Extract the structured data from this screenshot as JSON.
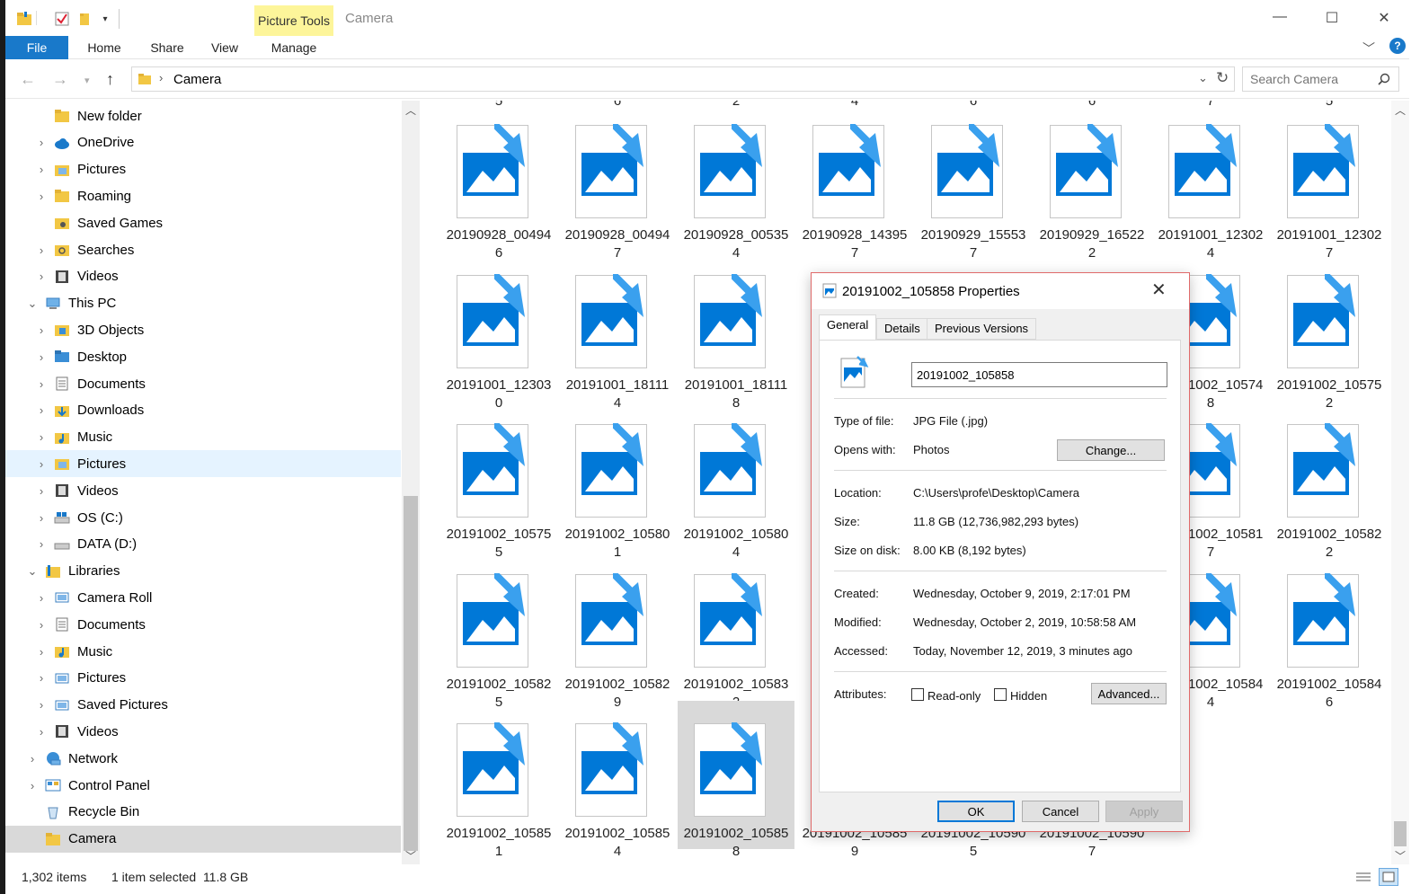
{
  "window": {
    "title": "Camera",
    "context_tab": "Picture Tools",
    "ribbon_tabs": [
      "File",
      "Home",
      "Share",
      "View",
      "Manage"
    ]
  },
  "address": {
    "path": "Camera",
    "search_placeholder": "Search Camera"
  },
  "nav_tree": [
    {
      "label": "New folder",
      "indent": 2,
      "chevron": "",
      "icon": "folder"
    },
    {
      "label": "OneDrive",
      "indent": 2,
      "chevron": ">",
      "icon": "cloud"
    },
    {
      "label": "Pictures",
      "indent": 2,
      "chevron": ">",
      "icon": "folder-pic"
    },
    {
      "label": "Roaming",
      "indent": 2,
      "chevron": ">",
      "icon": "folder"
    },
    {
      "label": "Saved Games",
      "indent": 2,
      "chevron": "",
      "icon": "folder-game"
    },
    {
      "label": "Searches",
      "indent": 2,
      "chevron": ">",
      "icon": "folder-search"
    },
    {
      "label": "Videos",
      "indent": 2,
      "chevron": ">",
      "icon": "video"
    },
    {
      "label": "This PC",
      "indent": 1,
      "chevron": "v",
      "icon": "pc"
    },
    {
      "label": "3D Objects",
      "indent": 2,
      "chevron": ">",
      "icon": "folder-3d"
    },
    {
      "label": "Desktop",
      "indent": 2,
      "chevron": ">",
      "icon": "desktop"
    },
    {
      "label": "Documents",
      "indent": 2,
      "chevron": ">",
      "icon": "doc"
    },
    {
      "label": "Downloads",
      "indent": 2,
      "chevron": ">",
      "icon": "download"
    },
    {
      "label": "Music",
      "indent": 2,
      "chevron": ">",
      "icon": "music"
    },
    {
      "label": "Pictures",
      "indent": 2,
      "chevron": ">",
      "icon": "folder-pic",
      "state": "hover"
    },
    {
      "label": "Videos",
      "indent": 2,
      "chevron": ">",
      "icon": "video"
    },
    {
      "label": "OS (C:)",
      "indent": 2,
      "chevron": ">",
      "icon": "drive-os"
    },
    {
      "label": "DATA (D:)",
      "indent": 2,
      "chevron": ">",
      "icon": "drive"
    },
    {
      "label": "Libraries",
      "indent": 1,
      "chevron": "v",
      "icon": "library"
    },
    {
      "label": "Camera Roll",
      "indent": 2,
      "chevron": ">",
      "icon": "lib-pic"
    },
    {
      "label": "Documents",
      "indent": 2,
      "chevron": ">",
      "icon": "doc"
    },
    {
      "label": "Music",
      "indent": 2,
      "chevron": ">",
      "icon": "music"
    },
    {
      "label": "Pictures",
      "indent": 2,
      "chevron": ">",
      "icon": "lib-pic"
    },
    {
      "label": "Saved Pictures",
      "indent": 2,
      "chevron": ">",
      "icon": "lib-pic"
    },
    {
      "label": "Videos",
      "indent": 2,
      "chevron": ">",
      "icon": "video"
    },
    {
      "label": "Network",
      "indent": 1,
      "chevron": ">",
      "icon": "network"
    },
    {
      "label": "Control Panel",
      "indent": 1,
      "chevron": ">",
      "icon": "control"
    },
    {
      "label": "Recycle Bin",
      "indent": 1,
      "chevron": "",
      "icon": "bin"
    },
    {
      "label": "Camera",
      "indent": 1,
      "chevron": "",
      "icon": "folder",
      "state": "selected"
    }
  ],
  "partial_row": [
    "5",
    "6",
    "2",
    "4",
    "6",
    "6",
    "7",
    "5"
  ],
  "files": [
    [
      "20190928_00494",
      "6"
    ],
    [
      "20190928_00494",
      "7"
    ],
    [
      "20190928_00535",
      "4"
    ],
    [
      "20190928_14395",
      "7"
    ],
    [
      "20190929_15553",
      "7"
    ],
    [
      "20190929_16522",
      "2"
    ],
    [
      "20191001_12302",
      "4"
    ],
    [
      "20191001_12302",
      "7"
    ],
    [
      "20191001_12303",
      "0"
    ],
    [
      "20191001_18111",
      "4"
    ],
    [
      "20191001_18111",
      "8"
    ],
    [
      "",
      ""
    ],
    [
      "",
      ""
    ],
    [
      "",
      ""
    ],
    [
      "20191002_10574",
      "8"
    ],
    [
      "20191002_10575",
      "2"
    ],
    [
      "20191002_10575",
      "5"
    ],
    [
      "20191002_10580",
      "1"
    ],
    [
      "20191002_10580",
      "4"
    ],
    [
      "",
      ""
    ],
    [
      "",
      ""
    ],
    [
      "",
      ""
    ],
    [
      "20191002_10581",
      "7"
    ],
    [
      "20191002_10582",
      "2"
    ],
    [
      "20191002_10582",
      "5"
    ],
    [
      "20191002_10582",
      "9"
    ],
    [
      "20191002_10583",
      "2"
    ],
    [
      "",
      ""
    ],
    [
      "",
      ""
    ],
    [
      "",
      ""
    ],
    [
      "20191002_10584",
      "4"
    ],
    [
      "20191002_10584",
      "6"
    ],
    [
      "20191002_10585",
      "1"
    ],
    [
      "20191002_10585",
      "4"
    ],
    [
      "20191002_10585",
      "8"
    ],
    [
      "20191002_10585",
      "9"
    ],
    [
      "20191002_10590",
      "5"
    ],
    [
      "20191002_10590",
      "7"
    ],
    [
      "",
      ""
    ],
    [
      "",
      ""
    ]
  ],
  "selected_file_index": 34,
  "status": {
    "count": "1,302 items",
    "selection": "1 item selected  11.8 GB"
  },
  "dialog": {
    "title": "20191002_105858 Properties",
    "tabs": [
      "General",
      "Details",
      "Previous Versions"
    ],
    "filename": "20191002_105858",
    "type_label": "Type of file:",
    "type_value": "JPG File (.jpg)",
    "opens_label": "Opens with:",
    "opens_value": "Photos",
    "change_btn": "Change...",
    "location_label": "Location:",
    "location_value": "C:\\Users\\profe\\Desktop\\Camera",
    "size_label": "Size:",
    "size_value": "11.8 GB (12,736,982,293 bytes)",
    "disk_label": "Size on disk:",
    "disk_value": "8.00 KB (8,192 bytes)",
    "created_label": "Created:",
    "created_value": "Wednesday, October 9, 2019, 2:17:01 PM",
    "modified_label": "Modified:",
    "modified_value": "Wednesday, October 2, 2019, 10:58:58 AM",
    "accessed_label": "Accessed:",
    "accessed_value": "Today, November 12, 2019, 3 minutes ago",
    "attr_label": "Attributes:",
    "readonly_label": "Read-only",
    "hidden_label": "Hidden",
    "advanced_btn": "Advanced...",
    "ok_btn": "OK",
    "cancel_btn": "Cancel",
    "apply_btn": "Apply"
  },
  "colors": {
    "accent": "#1979ca",
    "icon_blue": "#0078d7",
    "badge_blue": "#3aa0ee",
    "context_tab": "#fdf59a",
    "selection": "#d9d9d9",
    "hover": "#e5f3ff"
  }
}
